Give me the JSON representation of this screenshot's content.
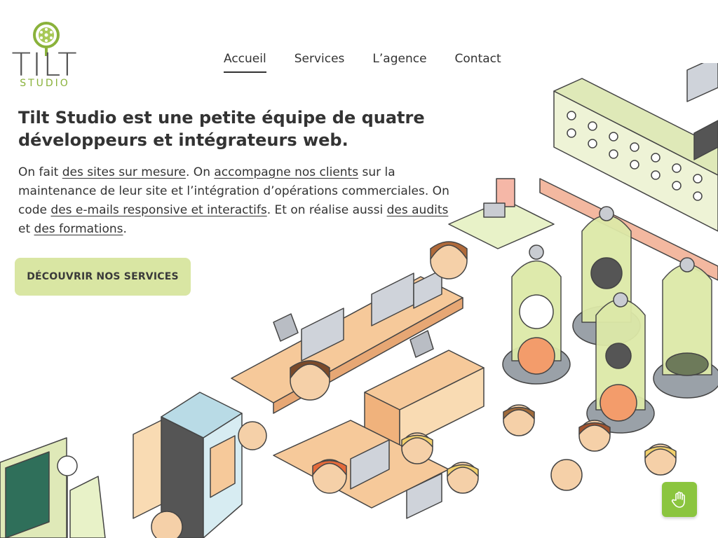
{
  "brand": {
    "name": "TILT",
    "sub": "STUDIO"
  },
  "nav": {
    "items": [
      {
        "label": "Accueil"
      },
      {
        "label": "Services"
      },
      {
        "label": "L’agence"
      },
      {
        "label": "Contact"
      }
    ],
    "active": "Accueil"
  },
  "hero": {
    "headline": "Tilt Studio est une petite équipe de quatre développeurs et intégrateurs web.",
    "intro": {
      "t1": "On fait ",
      "l1": "des sites sur mesure",
      "t2": ". On ",
      "l2": "accompagne nos clients",
      "t3": " sur la maintenance de leur site et l’intégration d’opérations commerciales. On code ",
      "l3": "des e-mails responsive et interactifs",
      "t4": ". Et on réalise aussi ",
      "l4": "des audits",
      "t5": " et ",
      "l5": "des formations",
      "t6": "."
    },
    "cta": "DÉCOUVRIR NOS SERVICES"
  },
  "colors": {
    "brand_green": "#8ab23b",
    "cta_bg": "#d9e6a3",
    "a11y_bg": "#8bc53f"
  },
  "icons": {
    "accessibility": "hand-icon"
  }
}
